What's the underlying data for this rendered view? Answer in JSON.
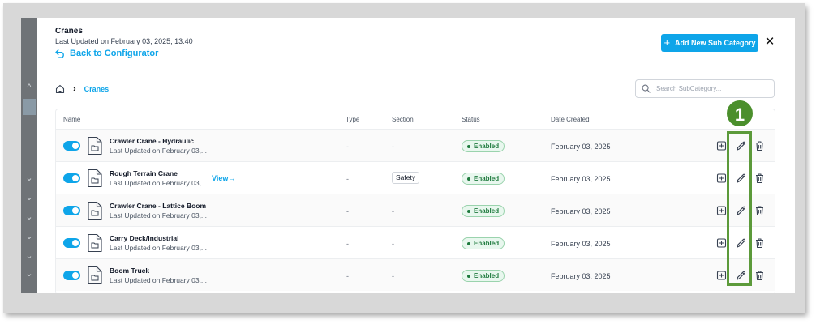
{
  "header": {
    "title": "Cranes",
    "last_updated": "Last Updated on February 03, 2025, 13:40",
    "back_label": "Back to Configurator",
    "add_button_label": "Add New Sub Category",
    "close_label": "✕"
  },
  "breadcrumb": {
    "separator": "›",
    "current": "Cranes"
  },
  "search": {
    "placeholder": "Search SubCategory..."
  },
  "table": {
    "columns": [
      "Name",
      "Type",
      "Section",
      "Status",
      "Date Created"
    ],
    "rows": [
      {
        "name": "Crawler Crane - Hydraulic",
        "updated": "Last Updated on February 03,...",
        "view": "",
        "type": "-",
        "section": "-",
        "status": "Enabled",
        "date": "February 03, 2025"
      },
      {
        "name": "Rough Terrain Crane",
        "updated": "Last Updated on February 03,...",
        "view": "View→",
        "type": "-",
        "section": "Safety",
        "status": "Enabled",
        "date": "February 03, 2025"
      },
      {
        "name": "Crawler Crane - Lattice Boom",
        "updated": "Last Updated on February 03,...",
        "view": "",
        "type": "-",
        "section": "-",
        "status": "Enabled",
        "date": "February 03, 2025"
      },
      {
        "name": "Carry Deck/Industrial",
        "updated": "Last Updated on February 03,...",
        "view": "",
        "type": "-",
        "section": "-",
        "status": "Enabled",
        "date": "February 03, 2025"
      },
      {
        "name": "Boom Truck",
        "updated": "Last Updated on February 03,...",
        "view": "",
        "type": "-",
        "section": "-",
        "status": "Enabled",
        "date": "February 03, 2025"
      }
    ]
  },
  "annotation": {
    "step_number": "1"
  },
  "icons": {
    "home": "home-icon",
    "search": "search-icon",
    "back": "back-arrow-icon",
    "file": "folder-file-icon",
    "add": "add-square-icon",
    "edit": "pencil-icon",
    "delete": "trash-icon"
  },
  "colors": {
    "accent": "#0ea5e9",
    "status_text": "#1e7a3d",
    "status_bg": "#e8f7ee",
    "highlight": "#5c9a3a"
  }
}
